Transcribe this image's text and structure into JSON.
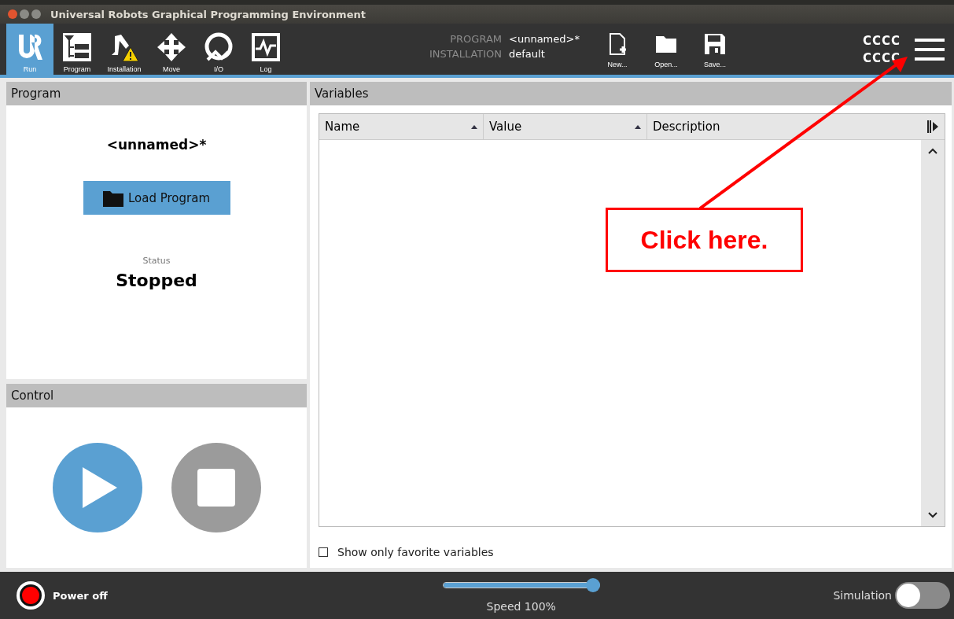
{
  "window": {
    "title": "Universal Robots Graphical Programming Environment"
  },
  "tabs": [
    {
      "label": "Run",
      "kind": "run",
      "selected": true
    },
    {
      "label": "Program",
      "kind": "program",
      "selected": false
    },
    {
      "label": "Installation",
      "kind": "installation",
      "selected": false
    },
    {
      "label": "Move",
      "kind": "move",
      "selected": false
    },
    {
      "label": "I/O",
      "kind": "io",
      "selected": false
    },
    {
      "label": "Log",
      "kind": "log",
      "selected": false
    }
  ],
  "file_info": [
    {
      "label": "PROGRAM",
      "value": "<unnamed>*"
    },
    {
      "label": "INSTALLATION",
      "value": "default"
    }
  ],
  "file_buttons": [
    {
      "label": "New...",
      "kind": "new"
    },
    {
      "label": "Open...",
      "kind": "open"
    },
    {
      "label": "Save...",
      "kind": "save"
    }
  ],
  "robot_name": [
    "CCCC",
    "CCCC"
  ],
  "program_panel": {
    "title": "Program",
    "program_name": "<unnamed>*",
    "load_button": "Load Program",
    "status_label": "Status",
    "status": "Stopped"
  },
  "control_panel": {
    "title": "Control"
  },
  "variables_panel": {
    "title": "Variables",
    "columns": [
      "Name",
      "Value",
      "Description"
    ],
    "favorites": {
      "label": "Show only favorite variables",
      "checked": false
    }
  },
  "bottom_bar": {
    "power": "Power off",
    "speed": {
      "label": "Speed 100%",
      "level": 1.0
    },
    "simulation": {
      "label": "Simulation",
      "on": false
    }
  },
  "annotation": {
    "text": "Click here."
  }
}
